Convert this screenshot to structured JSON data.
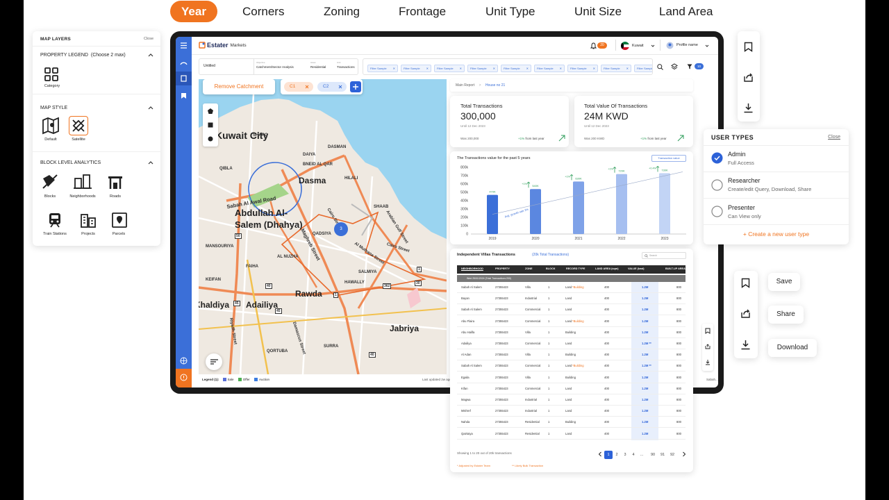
{
  "top_tabs": [
    "Year",
    "Corners",
    "Zoning",
    "Frontage",
    "Unit Type",
    "Unit Size",
    "Land Area"
  ],
  "map_layers": {
    "title": "MAP LAYERS",
    "close": "Close",
    "property_legend": "PROPERTY LEGEND",
    "property_legend_hint": "(Choose 2 max)",
    "category": "Category",
    "map_style": "MAP STYLE",
    "styles": [
      "Default",
      "Satellite"
    ],
    "block_analytics": "BLOCK LEVEL ANALYTICS",
    "blocks": [
      "Blocks",
      "Neighborhoods",
      "Roads",
      "Train Stations",
      "Projects",
      "Parcels"
    ]
  },
  "app": {
    "brand": "Estater",
    "brand_sub": "Markets",
    "notif_count": "20",
    "country": "Kuwait",
    "profile": "Profile name",
    "breadcrumb": {
      "untitled": "Untitled",
      "objective_lbl": "Objective",
      "objective": "Catchment/Sector Analysis",
      "asset_lbl": "Asset",
      "asset": "Residential",
      "unit_lbl": "Unit",
      "unit": "Transactions"
    },
    "filter_chip": "Filter Sample",
    "filter_count": "10"
  },
  "map": {
    "remove_btn": "Remove Catchment",
    "chips": [
      "C1",
      "C2"
    ],
    "cluster": "3",
    "labels": {
      "kuwait_city": "Kuwait City",
      "dasma": "Dasma",
      "abdullah": "Abdullah Al-",
      "salem": "Salem (Dhahya)",
      "rawda": "Rawda",
      "adailiya": "Adailiya",
      "jabriya": "Jabriya",
      "khaldiya": "Khaldiya",
      "qibla": "QIBLA",
      "sharq": "SHARQ",
      "daiya": "DAIYA",
      "shaab": "SHAAB",
      "bneid": "BNEID AL QAR",
      "qadsiya": "QADSIYA",
      "faiha": "FAIHA",
      "nuzha": "AL NUZHA",
      "surra": "SURRA",
      "qortuba": "QORTUBA",
      "mansouriya": "MANSOURIYA",
      "keifan": "KEIFAN",
      "salmiya": "SALMIYA",
      "hawally": "HAWALLY",
      "dasman": "DASMAN",
      "hilali": "HILALI"
    },
    "roads": {
      "r1": "Sabah Al Awal Road",
      "r2": "Maghreb Street",
      "r3": "Cairo Street",
      "r4": "Arabian Gulf Street",
      "r5": "Al Muthana Street",
      "r6": "Damascus Street",
      "r7": "Riyadh Street",
      "r8": "Cairo Street"
    },
    "road_nums": [
      "50",
      "45",
      "45",
      "40",
      "40",
      "30",
      "362",
      "1",
      "1"
    ],
    "legend_title": "Legend (1):",
    "legend": [
      "Sale",
      "Offer",
      "Auction"
    ],
    "legend_colors": [
      "#5a6fd8",
      "#4caf50",
      "#3b7ce0"
    ],
    "updated": "Last updated 2w ago"
  },
  "report": {
    "crumb_main": "Main Report",
    "crumb_house": "House no 21",
    "kpis": [
      {
        "title": "Total Transactions",
        "value": "300,000",
        "date": "Until 12 Dec 2023",
        "was": "Was 200,000",
        "change": "+1%",
        "change_text": "from last year"
      },
      {
        "title": "Total Value Of Transactions",
        "value": "24M KWD",
        "date": "Until 12 Dec 2023",
        "was": "Was 200 KWD",
        "change": "+1%",
        "change_text": "from last year"
      }
    ],
    "chart_title": "The Transactions value for the past 5 years",
    "chart_btn": "Transaction value",
    "table_title": "Independent Villas Transactions",
    "table_count": "(20k Total Transactions)",
    "table_search": "Search",
    "columns": [
      "NEIGHBORHOOD",
      "PROPERTY",
      "ZONE",
      "BLOCK",
      "RECORD TYPE",
      "LAND AREA (sqm)",
      "VALUE (kwd)",
      "BUILT-UP AREA"
    ],
    "group_row": "Wed 25/01/2024 (Total Transactions:200)",
    "rows": [
      [
        "Sabah Al Salem",
        "27355423",
        "Villa",
        "1",
        "Land",
        "*Building",
        "400",
        "1.2M",
        "800"
      ],
      [
        "Bayan",
        "27355423",
        "Industrial",
        "1",
        "Land",
        "",
        "400",
        "1.2M",
        "800"
      ],
      [
        "Sabah Al Salem",
        "27355423",
        "Commercial",
        "1",
        "Land",
        "",
        "400",
        "1.2M",
        "800"
      ],
      [
        "Abu Flaira",
        "27355423",
        "Commercial",
        "1",
        "Land",
        "*Building",
        "400",
        "1.2M",
        "800"
      ],
      [
        "Abu Halifa",
        "27355423",
        "Villa",
        "1",
        "Building",
        "",
        "400",
        "1.2M",
        "800"
      ],
      [
        "Adailiya",
        "27355423",
        "Commercial",
        "1",
        "Land",
        "",
        "400",
        "1.2M **",
        "800"
      ],
      [
        "Al Adan",
        "27355423",
        "Villa",
        "1",
        "Building",
        "",
        "400",
        "1.2M",
        "800"
      ],
      [
        "Sabah Al Salem",
        "27355423",
        "Commercial",
        "1",
        "Land",
        "*Building",
        "400",
        "1.2M **",
        "800"
      ],
      [
        "Egaila",
        "27355423",
        "Villa",
        "1",
        "Building",
        "",
        "400",
        "1.2M",
        "800"
      ],
      [
        "Kifan",
        "27355423",
        "Commercial",
        "1",
        "Land",
        "",
        "400",
        "1.2M",
        "800"
      ],
      [
        "Magwa",
        "27355423",
        "Industrial",
        "1",
        "Land",
        "",
        "400",
        "1.2M",
        "800"
      ],
      [
        "Mishref",
        "27355423",
        "Industrial",
        "1",
        "Land",
        "",
        "400",
        "1.2M",
        "800"
      ],
      [
        "Nahda",
        "27355423",
        "Residential",
        "1",
        "Building",
        "",
        "400",
        "1.2M",
        "800"
      ],
      [
        "Qairtaiya",
        "27355423",
        "Residential",
        "1",
        "Land",
        "",
        "400",
        "1.2M",
        "800"
      ]
    ],
    "showing": "Showing 1 to 20 out of 20k transactions",
    "pages": [
      "1",
      "2",
      "3",
      "4",
      "...",
      "90",
      "91",
      "92"
    ],
    "footnote1": "* Adjusted by Estater Team",
    "footnote2": "** Likely Bulk Transaction",
    "side_text": "Sabah..."
  },
  "chart_data": {
    "type": "bar",
    "categories": [
      "2019",
      "2020",
      "2021",
      "2022",
      "2023"
    ],
    "values": [
      470000,
      540000,
      630000,
      720000,
      730000
    ],
    "value_labels": [
      "470K",
      "540K",
      "630K",
      "720K",
      "730K"
    ],
    "growth_labels": [
      "+1%",
      "+1%",
      "+1%",
      "+0.4%"
    ],
    "trend_label": "Avg. growth rate 2%",
    "title": "The Transactions value for the past 5 years",
    "yticks": [
      "0",
      "100k",
      "200k",
      "300k",
      "400k",
      "500k",
      "600k",
      "700k",
      "800k"
    ],
    "ylim": [
      0,
      800000
    ],
    "colors": [
      "#3b6fd8",
      "#5b87e0",
      "#7fa2e8",
      "#a6bff0",
      "#c2d4f5"
    ]
  },
  "user_types": {
    "title": "USER TYPES",
    "close": "Close",
    "items": [
      {
        "name": "Admin",
        "desc": "Full Access"
      },
      {
        "name": "Researcher",
        "desc": "Create/edit Query, Download, Share"
      },
      {
        "name": "Presenter",
        "desc": "Can View only"
      }
    ],
    "create": "+ Create a new user type"
  },
  "actions": {
    "save": "Save",
    "share": "Share",
    "download": "Download"
  }
}
